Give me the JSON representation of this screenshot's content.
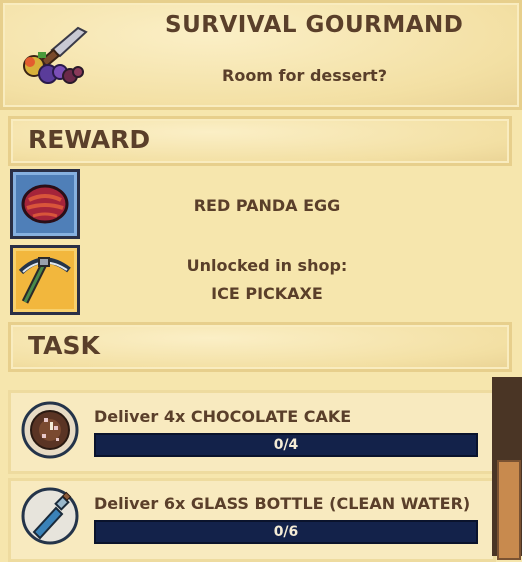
{
  "header": {
    "title": "SURVIVAL GOURMAND",
    "subtitle": "Room for dessert?",
    "icon": "knife-food-icon"
  },
  "reward": {
    "heading": "REWARD",
    "items": [
      {
        "icon": "red-panda-egg-icon",
        "label": "RED PANDA EGG"
      },
      {
        "icon": "ice-pickaxe-icon",
        "line1": "Unlocked in shop:",
        "line2": "ICE PICKAXE"
      }
    ]
  },
  "task": {
    "heading": "TASK",
    "rows": [
      {
        "icon": "chocolate-cake-icon",
        "label": "Deliver 4x CHOCOLATE CAKE",
        "progress_text": "0/4",
        "progress": 0
      },
      {
        "icon": "glass-bottle-icon",
        "label": "Deliver 6x GLASS BOTTLE (CLEAN WATER)",
        "progress_text": "0/6",
        "progress": 0
      }
    ]
  },
  "colors": {
    "parchment": "#f6e6ad",
    "text": "#5a3f2a",
    "progress_bar": "#13224a",
    "slot_blue": "#4f7fb8",
    "slot_gold": "#f2b73d"
  }
}
